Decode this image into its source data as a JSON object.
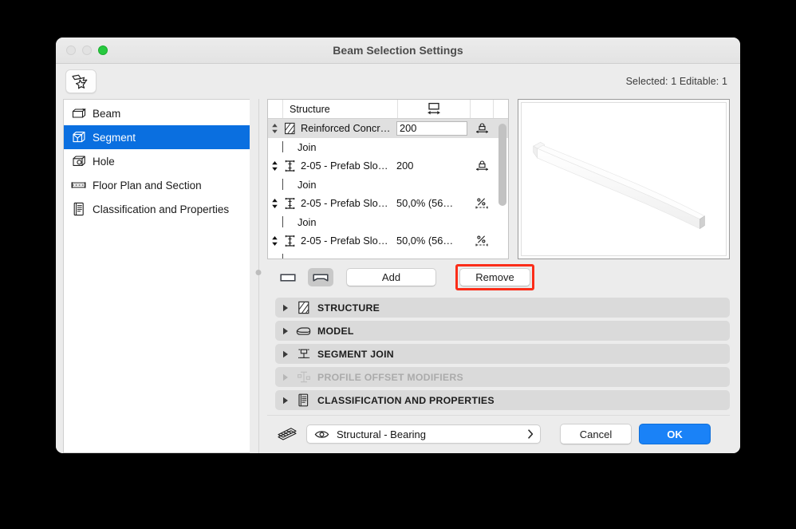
{
  "window": {
    "title": "Beam Selection Settings",
    "traffic_lights": [
      "close",
      "minimize",
      "maximize"
    ]
  },
  "toolbar": {
    "tool_icon": "magic-wand-pick-icon",
    "selection_status": "Selected: 1 Editable: 1"
  },
  "sidebar": {
    "items": [
      {
        "label": "Beam",
        "icon": "beam-icon",
        "active": false
      },
      {
        "label": "Segment",
        "icon": "segment-icon",
        "active": true
      },
      {
        "label": "Hole",
        "icon": "hole-icon",
        "active": false
      },
      {
        "label": "Floor Plan and Section",
        "icon": "floor-plan-section-icon",
        "active": false
      },
      {
        "label": "Classification and Properties",
        "icon": "classification-properties-icon",
        "active": false
      }
    ]
  },
  "structure_list": {
    "headers": {
      "col_structure": "Structure",
      "col_width_icon": "segment-width-icon"
    },
    "rows": [
      {
        "type": "segment",
        "icon": "hatch-concrete-icon",
        "name": "Reinforced Concr…",
        "value": "200",
        "value_editable": true,
        "lock_icon": "fixed-width-lock-icon",
        "selected": true
      },
      {
        "type": "join",
        "name": "Join"
      },
      {
        "type": "segment",
        "icon": "profile-i-beam-icon",
        "name": "2-05 - Prefab Slo…",
        "value": "200",
        "value_editable": false,
        "lock_icon": "fixed-width-lock-icon",
        "selected": false
      },
      {
        "type": "join",
        "name": "Join"
      },
      {
        "type": "segment",
        "icon": "profile-i-beam-icon",
        "name": "2-05 - Prefab Slo…",
        "value": "50,0% (56…",
        "value_editable": false,
        "lock_icon": "proportional-width-icon",
        "selected": false
      },
      {
        "type": "join",
        "name": "Join"
      },
      {
        "type": "segment",
        "icon": "profile-i-beam-icon",
        "name": "2-05 - Prefab Slo…",
        "value": "50,0% (56…",
        "value_editable": false,
        "lock_icon": "proportional-width-icon",
        "selected": false
      }
    ]
  },
  "preview": {
    "name": "beam-3d-preview"
  },
  "list_buttons": {
    "toggle_straight": {
      "icon": "straight-segment-icon",
      "active": false
    },
    "toggle_tapered": {
      "icon": "tapered-segment-icon",
      "active": true
    },
    "add_label": "Add",
    "remove_label": "Remove",
    "remove_highlight_color": "#fb2d19"
  },
  "accordions": [
    {
      "label": "STRUCTURE",
      "icon": "hatch-concrete-icon",
      "disabled": false
    },
    {
      "label": "MODEL",
      "icon": "model-box-icon",
      "disabled": false
    },
    {
      "label": "SEGMENT JOIN",
      "icon": "segment-join-icon",
      "disabled": false
    },
    {
      "label": "PROFILE OFFSET MODIFIERS",
      "icon": "profile-offset-icon",
      "disabled": true
    },
    {
      "label": "CLASSIFICATION AND PROPERTIES",
      "icon": "classification-properties-icon",
      "disabled": false
    }
  ],
  "footer": {
    "layers_icon": "layers-stack-icon",
    "layer_visibility_icon": "eye-icon",
    "layer_value": "Structural - Bearing",
    "layer_chevron": "chevron-right-icon",
    "cancel_label": "Cancel",
    "ok_label": "OK",
    "ok_color": "#1a82f7"
  }
}
